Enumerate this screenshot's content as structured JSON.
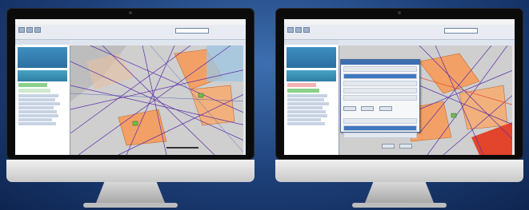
{
  "colors": {
    "background": "#1d3f78",
    "map_gray": "#c9c9c9",
    "region_orange": "#f5a46a",
    "route_purple": "#5a2ea6",
    "route_red": "#e05a38",
    "sidebar_blue": "#2f7ea4",
    "dialog_title": "#3d6fb0"
  },
  "monitors": [
    {
      "label": "left-monitor",
      "shows_dialog": false
    },
    {
      "label": "right-monitor",
      "shows_dialog": true
    }
  ],
  "icons": [
    "webcam-icon",
    "map-pin-icon",
    "folder-icon"
  ]
}
